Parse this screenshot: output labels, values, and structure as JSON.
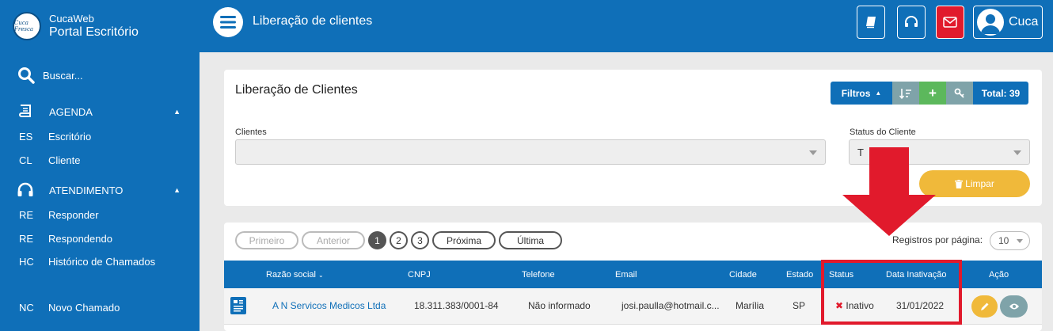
{
  "brand": {
    "logo_text": "Cuca Fresca",
    "app_name": "CucaWeb",
    "portal_name": "Portal Escritório"
  },
  "sidebar": {
    "search_placeholder": "Buscar...",
    "sections": [
      {
        "label": "AGENDA",
        "icon": "book-icon",
        "items": [
          {
            "abbr": "ES",
            "label": "Escritório"
          },
          {
            "abbr": "CL",
            "label": "Cliente"
          }
        ]
      },
      {
        "label": "ATENDIMENTO",
        "icon": "headset-icon",
        "items": [
          {
            "abbr": "RE",
            "label": "Responder"
          },
          {
            "abbr": "RE",
            "label": "Respondendo"
          },
          {
            "abbr": "HC",
            "label": "Histórico de Chamados"
          }
        ]
      }
    ],
    "extra_item": {
      "abbr": "NC",
      "label": "Novo Chamado"
    }
  },
  "topbar": {
    "title": "Liberação de clientes",
    "buttons": [
      "book-icon",
      "headset-icon",
      "envelope-icon"
    ],
    "user_name": "Cuca"
  },
  "filters": {
    "title": "Liberação de Clientes",
    "filtros_label": "Filtros",
    "total_label": "Total: 39",
    "clientes_label": "Clientes",
    "clientes_value": "",
    "status_label": "Status do Cliente",
    "status_value": "T",
    "limpar_label": "Limpar"
  },
  "pagination": {
    "first": "Primeiro",
    "prev": "Anterior",
    "pages": [
      "1",
      "2",
      "3"
    ],
    "active_page": "1",
    "next": "Próxima",
    "last": "Última",
    "rpp_label": "Registros por página:",
    "rpp_value": "10"
  },
  "table": {
    "headers": {
      "razao": "Razão social",
      "cnpj": "CNPJ",
      "telefone": "Telefone",
      "email": "Email",
      "cidade": "Cidade",
      "estado": "Estado",
      "status": "Status",
      "data": "Data Inativação",
      "acao": "Ação"
    },
    "rows": [
      {
        "razao": "A N Servicos Medicos Ltda",
        "cnpj": "18.311.383/0001-84",
        "telefone": "Não informado",
        "email": "josi.paulla@hotmail.c...",
        "cidade": "Marília",
        "estado": "SP",
        "status": "Inativo",
        "data": "31/01/2022"
      }
    ]
  },
  "colors": {
    "primary": "#0f6fb8",
    "red": "#e11a2c",
    "green": "#5cb85c",
    "yellow": "#f0b93a",
    "gray_btn": "#7fa3a9"
  }
}
